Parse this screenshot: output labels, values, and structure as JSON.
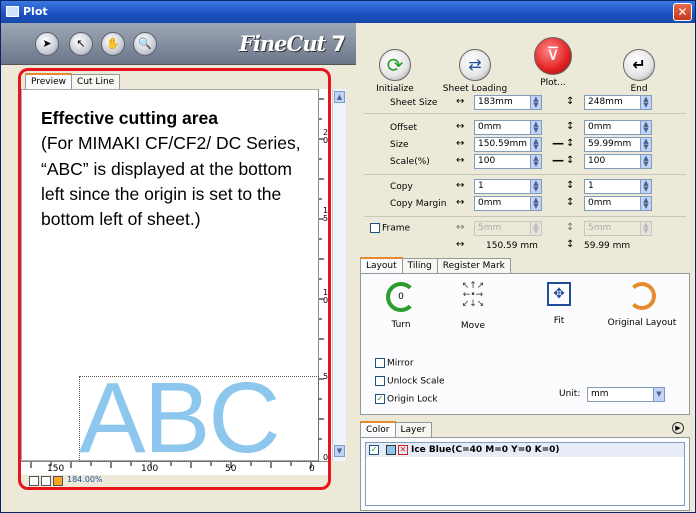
{
  "window": {
    "title": "Plot",
    "close_glyph": "✕"
  },
  "toolbar": {
    "tools": [
      {
        "icon": "selection-arrow-icon",
        "glyph": "➤"
      },
      {
        "icon": "pointer-arrow-icon",
        "glyph": "↖"
      },
      {
        "icon": "hand-icon",
        "glyph": "✋"
      },
      {
        "icon": "zoom-icon",
        "glyph": "🔍"
      }
    ],
    "logo_text": "FineCut",
    "logo_version": "7"
  },
  "actions": [
    {
      "label": "Initialize",
      "icon": "refresh-icon",
      "glyph": "⟳",
      "color": "#2a9d2a"
    },
    {
      "label": "Sheet Loading",
      "icon": "sheet-loading-icon",
      "glyph": "⇄",
      "color": "#1f4f9a"
    },
    {
      "label": "Plot...",
      "icon": "plotter-icon",
      "glyph": "⊽",
      "color": "#d3201f"
    },
    {
      "label": "End",
      "icon": "return-icon",
      "glyph": "↵",
      "color": "#000000"
    }
  ],
  "sheet": {
    "sheet_size": {
      "label": "Sheet Size",
      "w": "183mm",
      "h": "248mm"
    },
    "offset": {
      "label": "Offset",
      "w": "0mm",
      "h": "0mm"
    },
    "size": {
      "label": "Size",
      "w": "150.59mm",
      "h": "59.99mm"
    },
    "scale": {
      "label": "Scale(%)",
      "w": "100",
      "h": "100"
    },
    "copy": {
      "label": "Copy",
      "w": "1",
      "h": "1"
    },
    "copy_margin": {
      "label": "Copy Margin",
      "w": "0mm",
      "h": "0mm"
    },
    "frame": {
      "label": "Frame",
      "w": "5mm",
      "h": "5mm"
    },
    "result_w": "150.59 mm",
    "result_h": "59.99 mm"
  },
  "layout_tabs": [
    "Layout",
    "Tiling",
    "Register Mark"
  ],
  "layout": {
    "turn": "Turn",
    "move": "Move",
    "fit": "Fit",
    "original_layout": "Original Layout",
    "mirror": "Mirror",
    "unlock_scale": "Unlock Scale",
    "origin_lock": "Origin Lock",
    "unit_label": "Unit:",
    "unit_value": "mm"
  },
  "color_tabs": [
    "Color",
    "Layer"
  ],
  "color_list": [
    {
      "name": "Ice Blue(C=40 M=0 Y=0 K=0)",
      "checked": true,
      "swatch": "#8ec7ee"
    }
  ],
  "preview_tabs": [
    "Preview",
    "Cut Line"
  ],
  "annotation": {
    "heading": "Effective cutting area",
    "body": "(For MIMAKI CF/CF2/ DC Series, “ABC” is displayed at the bottom left since the origin is set to the bottom left of sheet.)"
  },
  "canvas": {
    "art_text": "ABC",
    "art_color": "#8ec7ee",
    "zoom": "184.00%"
  },
  "hruler_labels": [
    "150",
    "100",
    "50",
    "0"
  ],
  "vruler_labels": [
    "2 0",
    "1 5",
    "1 0",
    "5",
    "0"
  ]
}
